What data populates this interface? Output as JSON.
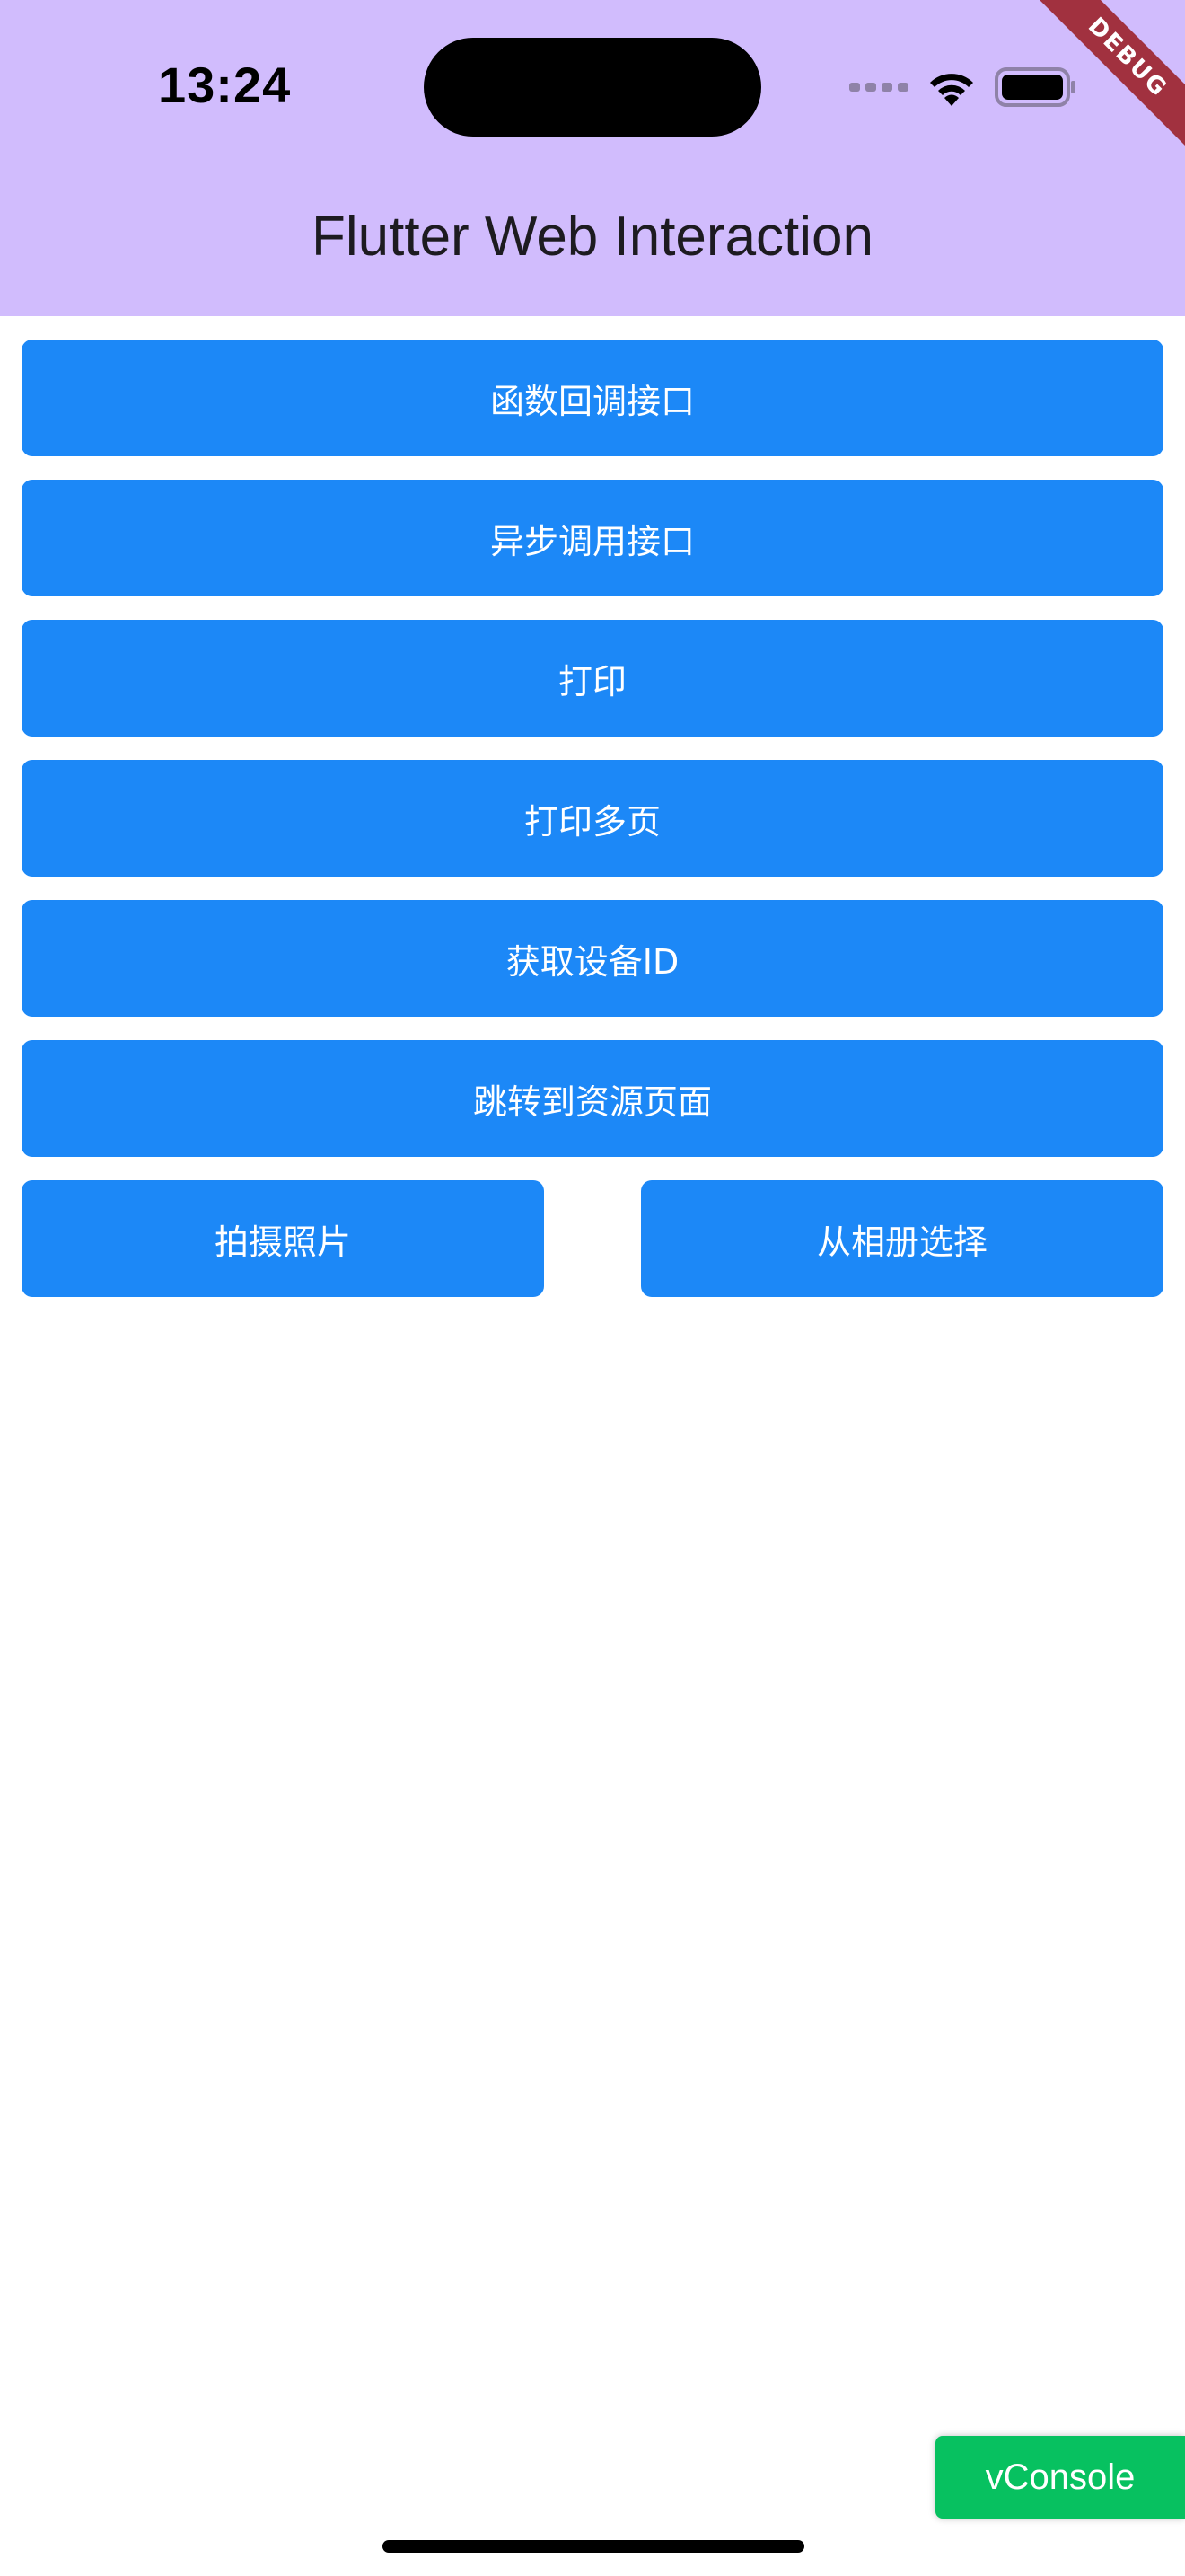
{
  "status_bar": {
    "time": "13:24"
  },
  "app_bar": {
    "title": "Flutter Web Interaction",
    "background_color": "#d1bcfd"
  },
  "debug_banner": {
    "label": "DEBUG"
  },
  "buttons": {
    "function_callback": "函数回调接口",
    "async_call": "异步调用接口",
    "print": "打印",
    "print_multi": "打印多页",
    "get_device_id": "获取设备ID",
    "goto_resource": "跳转到资源页面",
    "take_photo": "拍摄照片",
    "choose_album": "从相册选择",
    "color": "#1c88f7"
  },
  "vconsole": {
    "label": "vConsole",
    "color": "#07c160"
  },
  "icons": [
    "wifi-icon",
    "battery-icon",
    "signal-icon"
  ]
}
